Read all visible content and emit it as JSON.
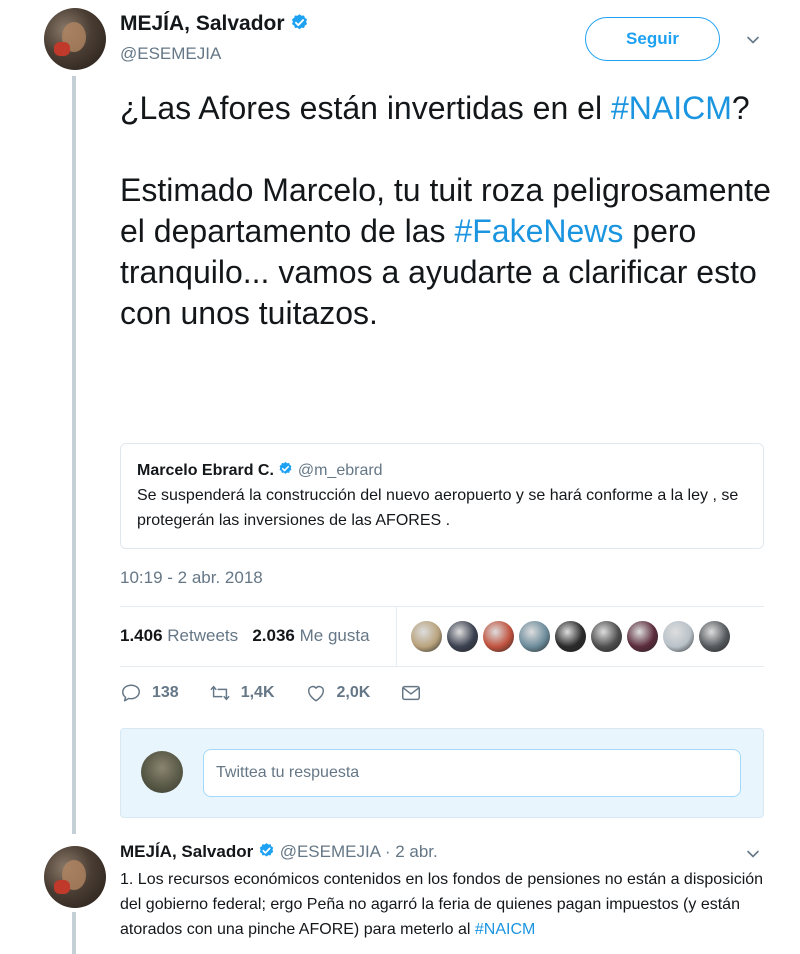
{
  "main_tweet": {
    "author_name": "MEJÍA, Salvador",
    "author_handle": "@ESEMEJIA",
    "follow_label": "Seguir",
    "paragraph1": {
      "before": "¿Las Afores están invertidas en el",
      "hashtag": "#NAICM",
      "after": "?"
    },
    "paragraph2": {
      "part1": "Estimado Marcelo, tu tuit roza peligrosamente el departamento de las",
      "hashtag": "#FakeNews",
      "part2": "pero tranquilo... vamos a ayudarte a clarificar esto con unos tuitazos."
    },
    "timestamp": "10:19 - 2 abr. 2018"
  },
  "quoted_tweet": {
    "author_name": "Marcelo Ebrard C.",
    "author_handle": "@m_ebrard",
    "text": "Se suspenderá la construcción del nuevo aeropuerto y se hará conforme a la ley , se protegerán las inversiones de las AFORES ."
  },
  "stats": {
    "retweets_count": "1.406",
    "retweets_label": "Retweets",
    "likes_count": "2.036",
    "likes_label": "Me gusta"
  },
  "likers": [
    {
      "name": "liker-1",
      "color": "#b8a27c"
    },
    {
      "name": "liker-2",
      "color": "#3b4150"
    },
    {
      "name": "liker-3",
      "color": "#c0523e"
    },
    {
      "name": "liker-4",
      "color": "#6c8c9c"
    },
    {
      "name": "liker-5",
      "color": "#2a2a2a"
    },
    {
      "name": "liker-6",
      "color": "#4d4d4d"
    },
    {
      "name": "liker-7",
      "color": "#5c2c3c"
    },
    {
      "name": "liker-8",
      "color": "#b9c2c9"
    },
    {
      "name": "liker-9",
      "color": "#555a5e"
    }
  ],
  "actions": {
    "replies": "138",
    "retweets": "1,4K",
    "likes": "2,0K"
  },
  "reply": {
    "placeholder": "Twittea tu respuesta"
  },
  "second_tweet": {
    "author_name": "MEJÍA, Salvador",
    "author_handle": "@ESEMEJIA",
    "date": "· 2 abr.",
    "text_before": "1. Los recursos económicos contenidos en los fondos de pensiones no están a disposición del gobierno federal; ergo Peña no agarró la feria de quienes pagan impuestos (y están atorados con una pinche AFORE) para meterlo al",
    "hashtag": "#NAICM"
  },
  "colors": {
    "accent": "#1da1f2",
    "hashtag": "#1b95e0",
    "muted": "#657786",
    "thread_line": "#c4cfd6"
  }
}
